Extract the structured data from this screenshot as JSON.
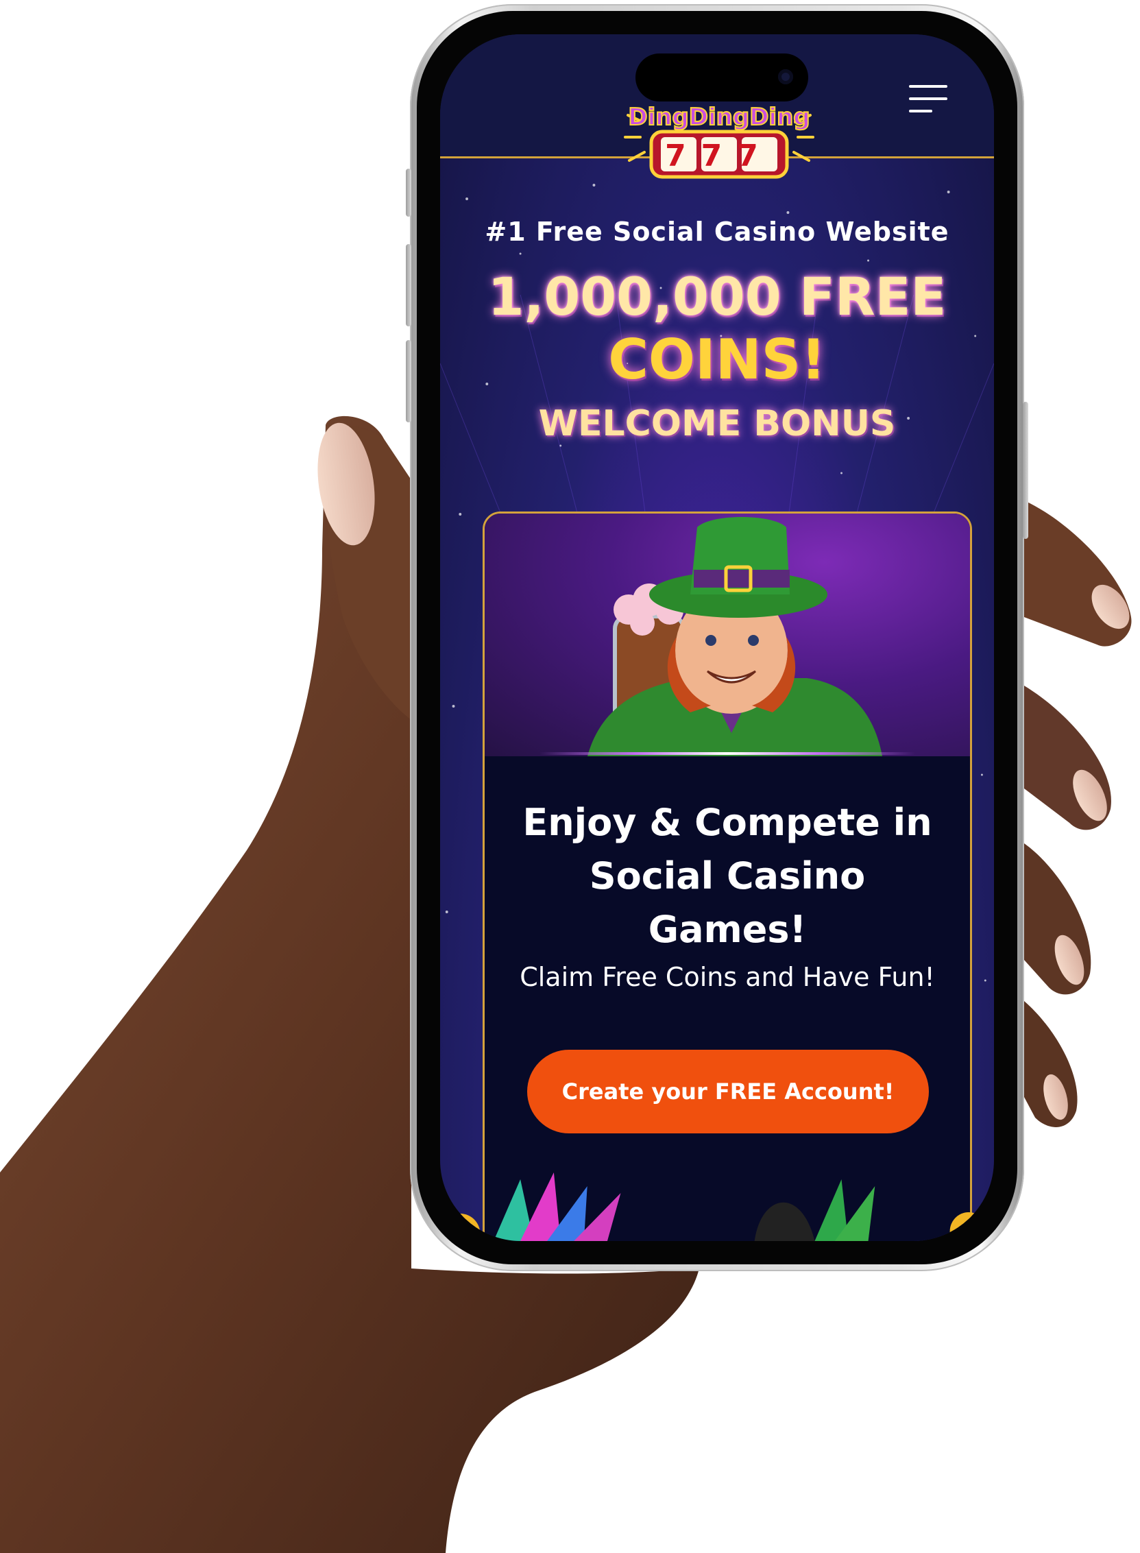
{
  "header": {
    "menu_icon": "hamburger-menu-icon",
    "logo": {
      "word": "DingDingDing",
      "digits": "777"
    }
  },
  "hero": {
    "tagline": "#1 Free Social Casino Website",
    "coins_line1": "1,000,000 FREE",
    "coins_line2": "COINS!",
    "welcome": "WELCOME BONUS"
  },
  "card": {
    "title_line1": "Enjoy & Compete in",
    "title_line2": "Social Casino",
    "title_line3": "Games!",
    "subtitle": "Claim Free Coins and Have Fun!",
    "cta_label": "Create your FREE Account!"
  },
  "colors": {
    "accent": "#f0500e",
    "gold": "#d4a23c",
    "background": "#151545"
  }
}
